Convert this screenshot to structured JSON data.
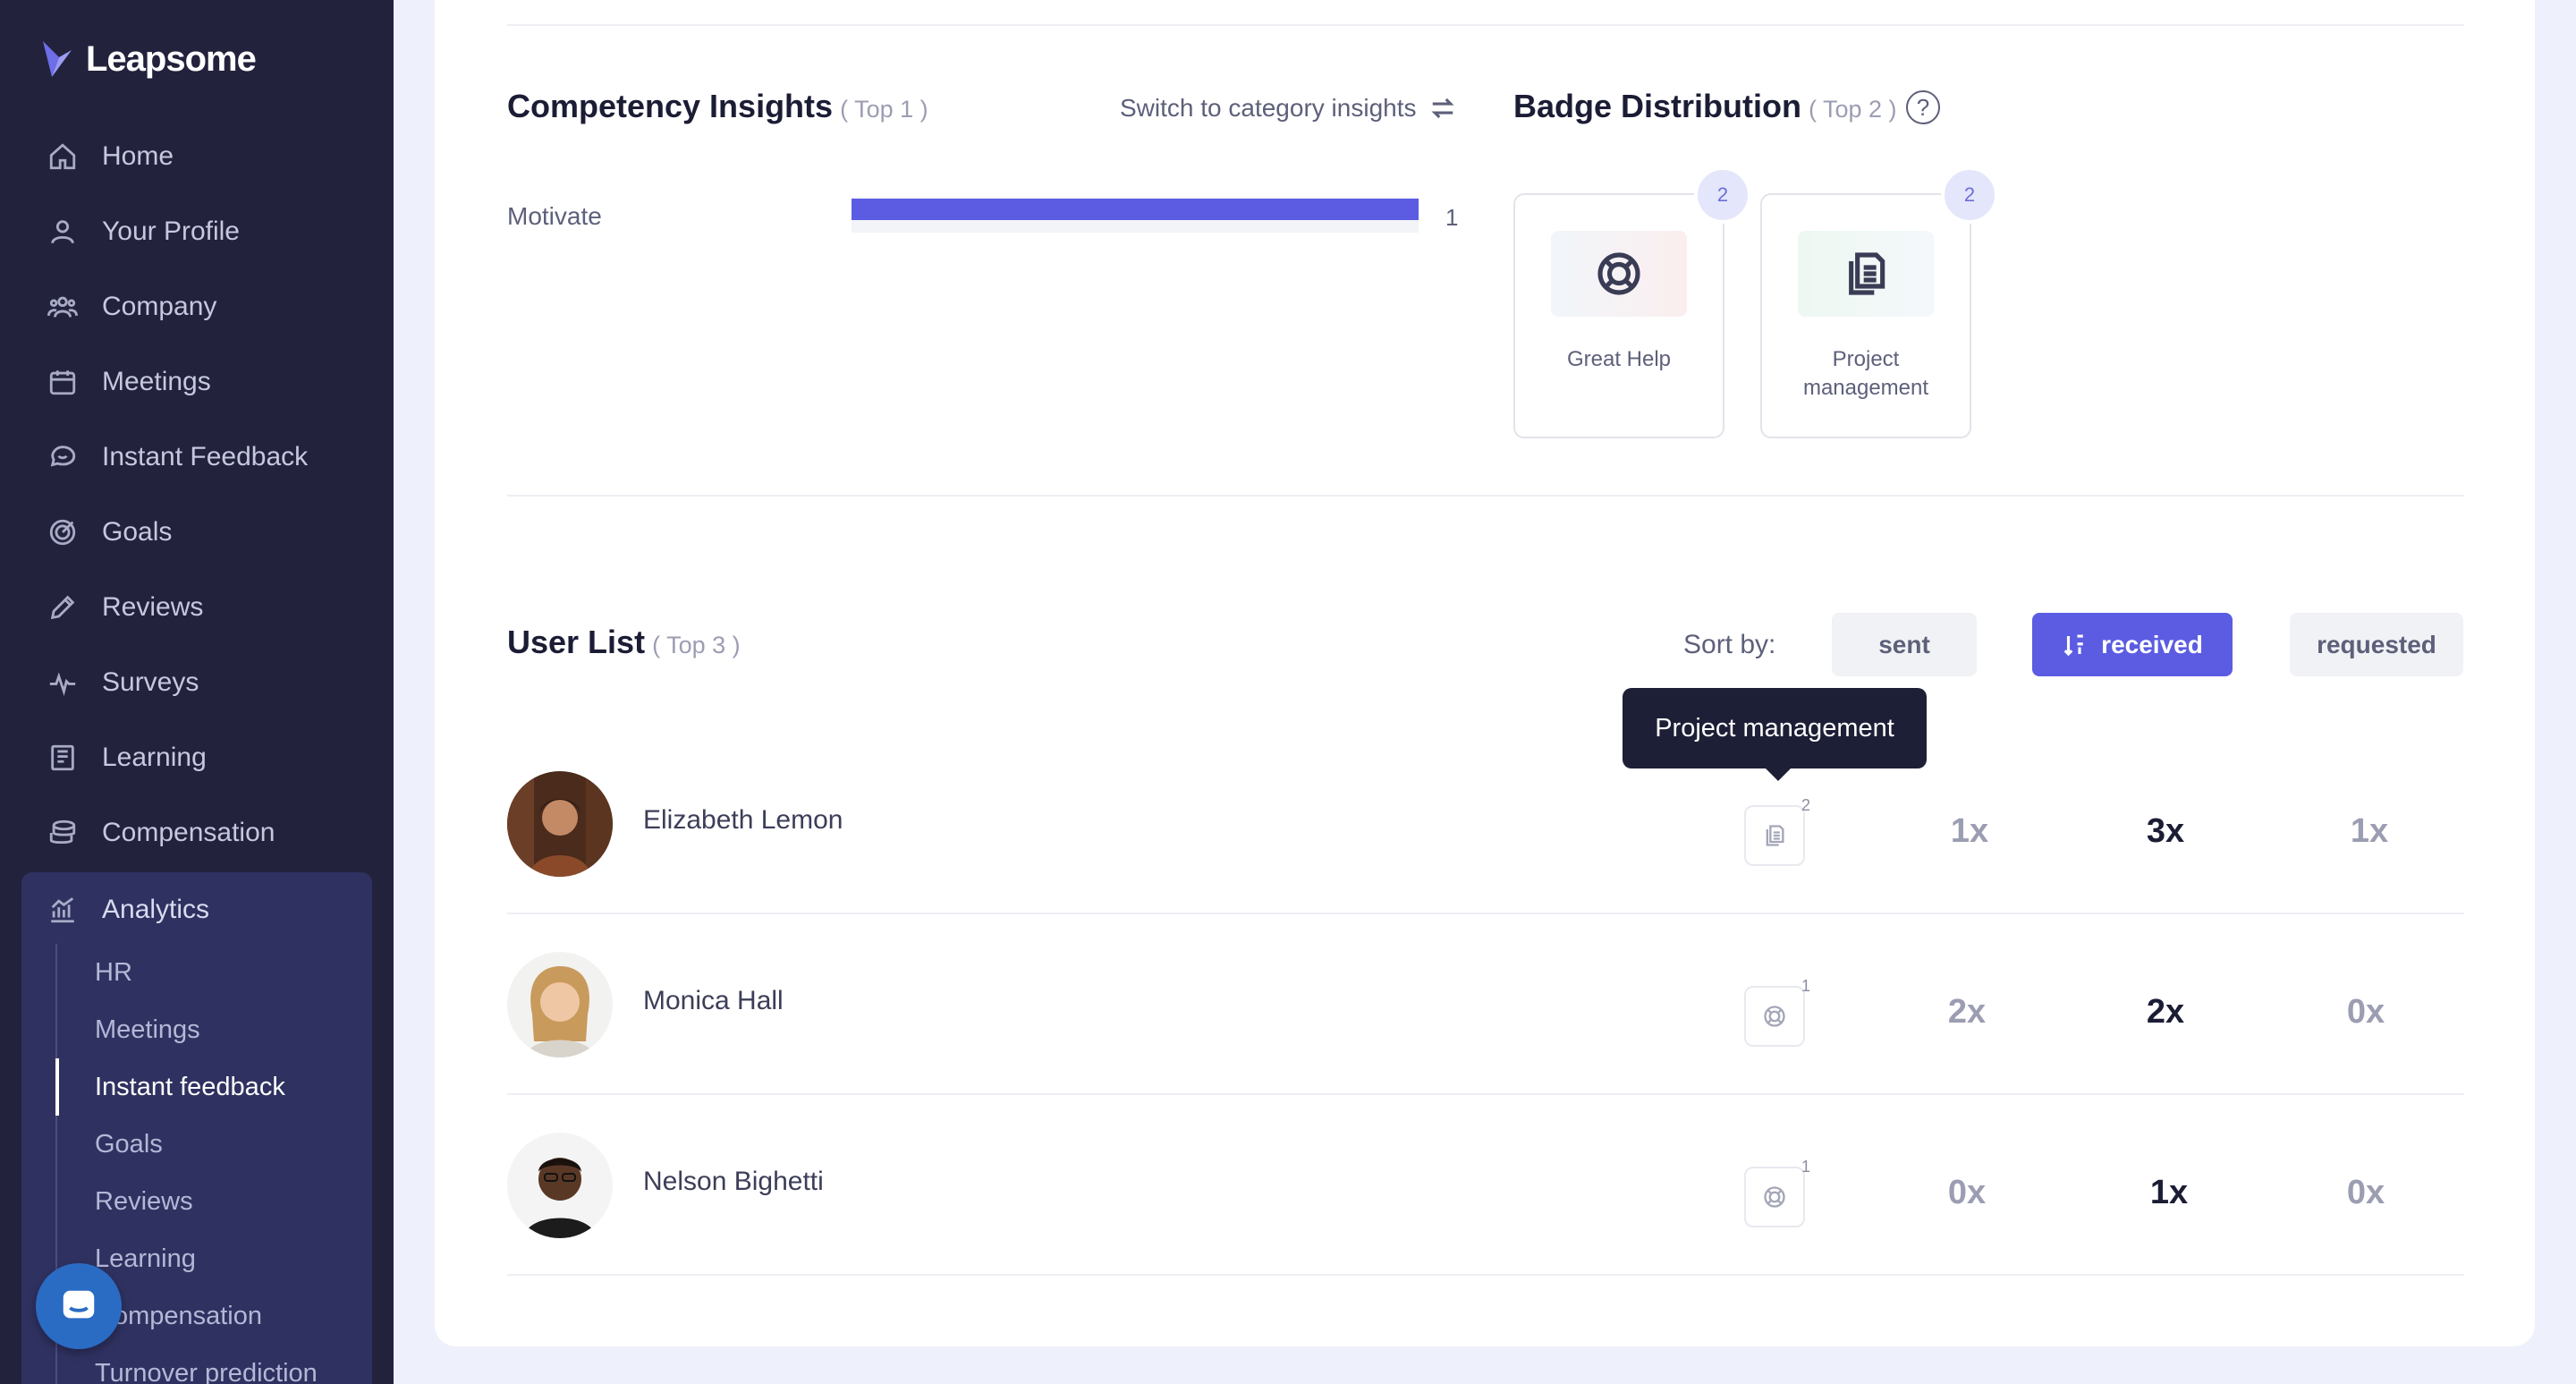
{
  "brand": {
    "name": "Leapsome"
  },
  "sidebar": {
    "items": [
      {
        "label": "Home",
        "icon": "home-icon"
      },
      {
        "label": "Your Profile",
        "icon": "user-icon"
      },
      {
        "label": "Company",
        "icon": "users-icon"
      },
      {
        "label": "Meetings",
        "icon": "calendar-icon"
      },
      {
        "label": "Instant Feedback",
        "icon": "chat-icon"
      },
      {
        "label": "Goals",
        "icon": "target-icon"
      },
      {
        "label": "Reviews",
        "icon": "pen-icon"
      },
      {
        "label": "Surveys",
        "icon": "pulse-icon"
      },
      {
        "label": "Learning",
        "icon": "book-icon"
      },
      {
        "label": "Compensation",
        "icon": "coins-icon"
      }
    ],
    "analytics": {
      "label": "Analytics",
      "icon": "chart-icon",
      "sub_items": [
        "HR",
        "Meetings",
        "Instant feedback",
        "Goals",
        "Reviews",
        "Learning",
        "Compensation",
        "Turnover prediction"
      ],
      "active": "Instant feedback"
    }
  },
  "competency": {
    "title": "Competency Insights",
    "subtitle": "( Top 1 )",
    "switch_label": "Switch to category insights",
    "bars": [
      {
        "label": "Motivate",
        "value": 1,
        "max": 1
      }
    ]
  },
  "badges": {
    "title": "Badge Distribution",
    "subtitle": "( Top 2 )",
    "help": "?",
    "items": [
      {
        "name": "Great Help",
        "count": "2",
        "icon": "lifebuoy-icon"
      },
      {
        "name": "Project management",
        "count": "2",
        "icon": "documents-icon"
      }
    ]
  },
  "user_list": {
    "title": "User List",
    "subtitle": "( Top 3 )",
    "sort_label": "Sort by:",
    "sort_options": [
      "sent",
      "received",
      "requested"
    ],
    "sort_active": "received",
    "tooltip": "Project management",
    "users": [
      {
        "name": "Elizabeth Lemon",
        "badge_icon": "documents-icon",
        "badge_count": "2",
        "sent": "1x",
        "received": "3x",
        "requested": "1x"
      },
      {
        "name": "Monica Hall",
        "badge_icon": "lifebuoy-icon",
        "badge_count": "1",
        "sent": "2x",
        "received": "2x",
        "requested": "0x"
      },
      {
        "name": "Nelson Bighetti",
        "badge_icon": "lifebuoy-icon",
        "badge_count": "1",
        "sent": "0x",
        "received": "1x",
        "requested": "0x"
      }
    ]
  },
  "colors": {
    "sidebar": "#22223d",
    "accent": "#5b5ce2",
    "analytics_bg": "#2f3160"
  }
}
